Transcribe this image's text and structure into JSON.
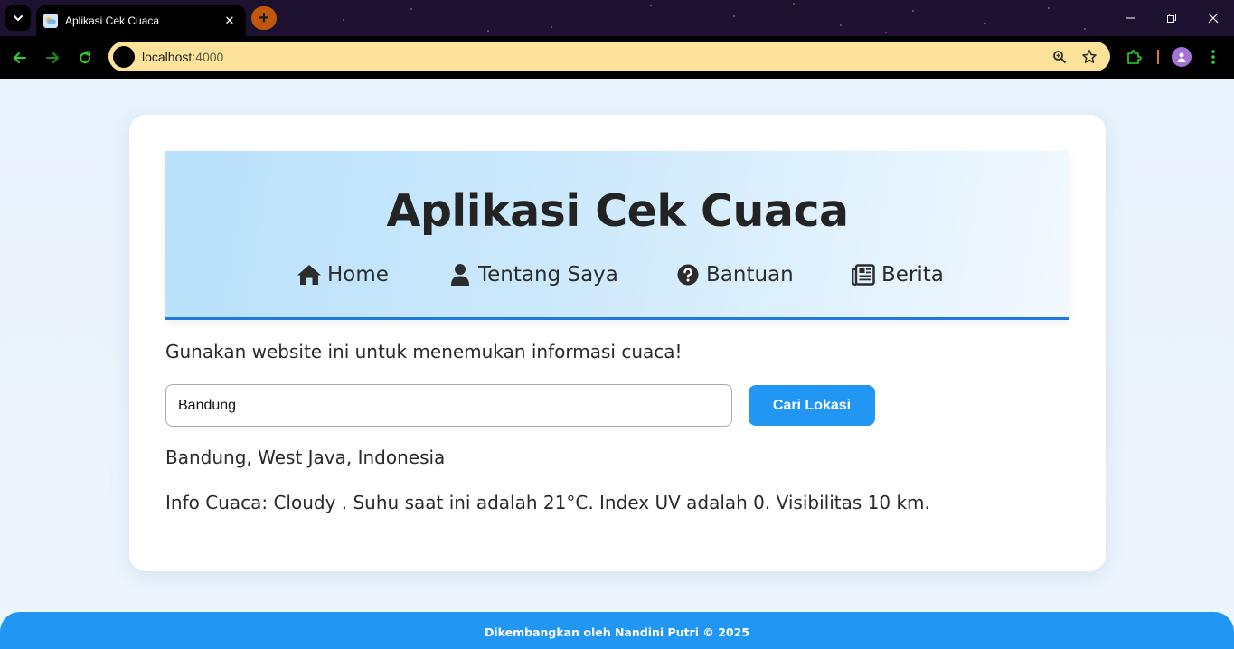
{
  "browser": {
    "tab_title": "Aplikasi Cek Cuaca",
    "tab_close": "✕",
    "new_tab": "+",
    "url_host": "localhost",
    "url_port": ":4000",
    "colors": {
      "omnibox": "#fde29a",
      "tabbar": "#1c1230",
      "toolbar": "#000000",
      "accent": "#e0731c"
    },
    "icons": [
      "tab-list-icon",
      "weather-favicon-icon",
      "back-icon",
      "forward-icon",
      "reload-icon",
      "site-info-icon",
      "zoom-icon",
      "star-icon",
      "extension-icon",
      "profile-icon",
      "menu-icon",
      "minimize-icon",
      "restore-icon",
      "close-window-icon"
    ]
  },
  "header": {
    "title": "Aplikasi Cek Cuaca",
    "nav": [
      {
        "label": "Home",
        "icon": "home-icon"
      },
      {
        "label": "Tentang Saya",
        "icon": "user-icon"
      },
      {
        "label": "Bantuan",
        "icon": "question-circle-icon"
      },
      {
        "label": "Berita",
        "icon": "newspaper-icon"
      }
    ]
  },
  "main": {
    "intro": "Gunakan website ini untuk menemukan informasi cuaca!",
    "search": {
      "value": "Bandung",
      "placeholder": "",
      "button_label": "Cari Lokasi"
    },
    "location": "Bandung, West Java, Indonesia",
    "forecast": "Info Cuaca: Cloudy . Suhu saat ini adalah 21°C. Index UV adalah 0. Visibilitas 10 km."
  },
  "footer": {
    "text": "Dikembangkan oleh Nandini Putri © 2025"
  },
  "theme": {
    "primary": "#2196f3",
    "hero_border": "#1f7ae0",
    "page_bg": "#eaf4fd",
    "text": "#2a2a2a"
  }
}
